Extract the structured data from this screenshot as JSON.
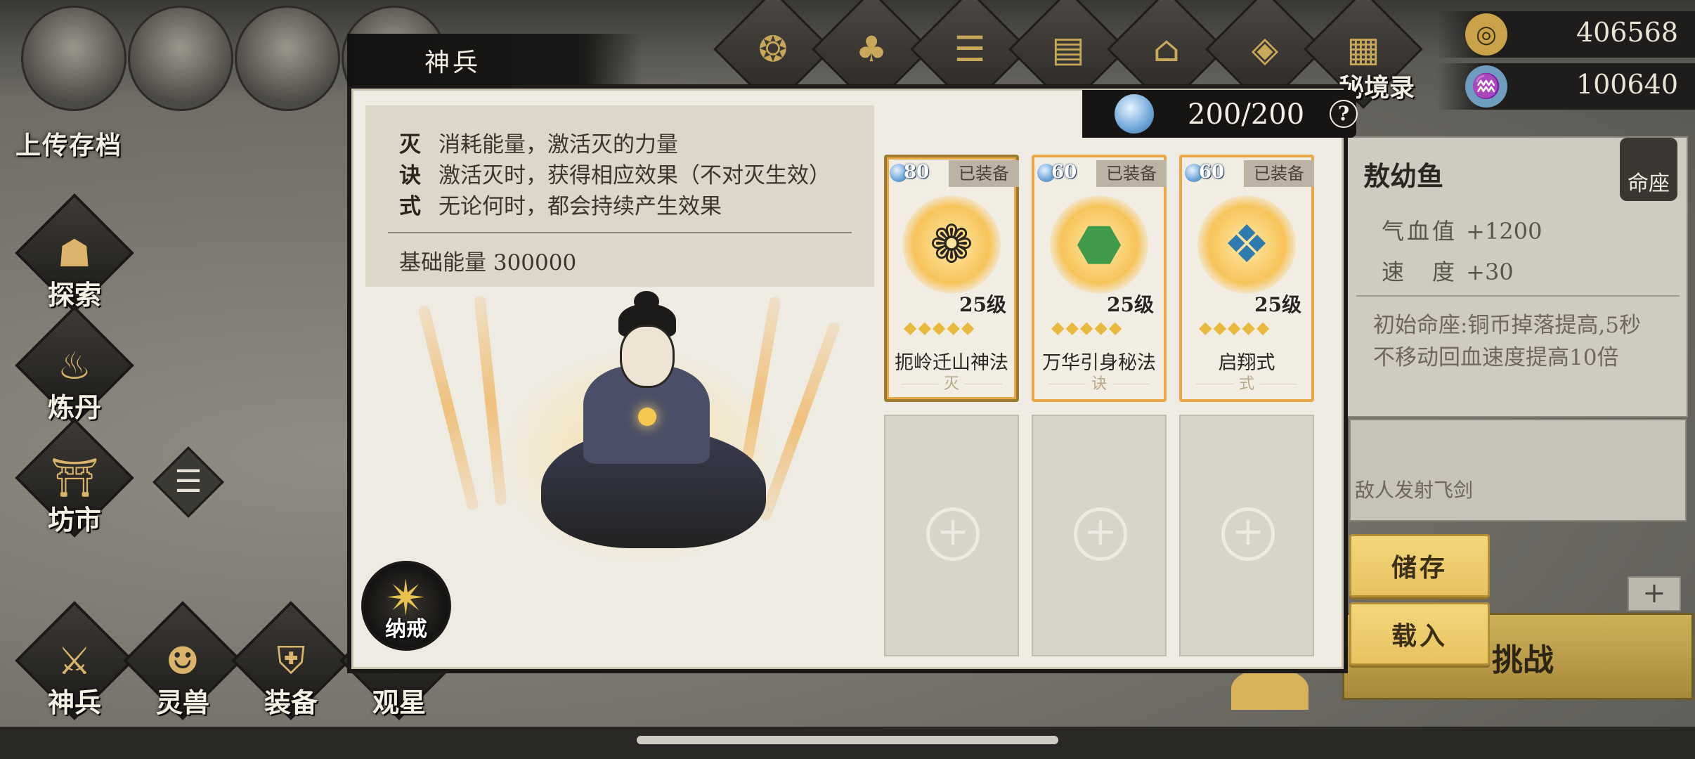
{
  "background": {
    "save_label": "上传存档",
    "nav": [
      {
        "id": "explore",
        "label": "探索",
        "icon": "lantern-icon"
      },
      {
        "id": "alchemy",
        "label": "炼丹",
        "icon": "cauldron-icon"
      },
      {
        "id": "market",
        "label": "坊市",
        "icon": "market-icon"
      }
    ],
    "bottom_nav": [
      {
        "id": "weapon",
        "label": "神兵",
        "icon": "sword-icon"
      },
      {
        "id": "beast",
        "label": "灵兽",
        "icon": "beast-mask-icon"
      },
      {
        "id": "equipment",
        "label": "装备",
        "icon": "armor-icon"
      },
      {
        "id": "stars",
        "label": "观星",
        "icon": "star-icon"
      }
    ],
    "secret_label": "秘境录",
    "resources": {
      "coins": "406568",
      "spirit": "100640"
    },
    "character": {
      "name": "敖幼鱼",
      "badge": "命座",
      "stats": [
        {
          "key": "气血值",
          "value": "+1200"
        },
        {
          "key": "速　度",
          "value": "+30"
        }
      ],
      "description": "初始命座:铜币掉落提高,5秒不移动回血速度提高10倍",
      "effect_text": "敌人发射飞剑"
    },
    "challenge_label": "挑战"
  },
  "modal": {
    "title": "神兵",
    "rules": [
      {
        "key": "灭",
        "text": "消耗能量，激活灭的力量"
      },
      {
        "key": "诀",
        "text": "激活灭时，获得相应效果（不对灭生效）"
      },
      {
        "key": "式",
        "text": "无论何时，都会持续产生效果"
      }
    ],
    "base_energy_label": "基础能量 300000",
    "ring_label": "纳戒",
    "energy": "200/200",
    "help": "?",
    "cards": [
      {
        "cost": "80",
        "equipped": "已装备",
        "level": "25级",
        "stars": "◆◆◆◆◆",
        "name": "扼岭迁山神法",
        "type": "灭",
        "art_icon": "dragon-ring-icon"
      },
      {
        "cost": "60",
        "equipped": "已装备",
        "level": "25级",
        "stars": "◆◆◆◆◆",
        "name": "万华引身秘法",
        "type": "诀",
        "art_icon": "jade-coin-icon"
      },
      {
        "cost": "60",
        "equipped": "已装备",
        "level": "25级",
        "stars": "◆◆◆◆◆",
        "name": "启翔式",
        "type": "式",
        "art_icon": "scroll-artifact-icon"
      }
    ],
    "empty_slot_symbol": "+"
  },
  "actions": {
    "save": "储存",
    "load": "载入"
  },
  "colors": {
    "gold": "#e9a74a",
    "button": "#f4d67d",
    "panel": "#eeebe3"
  }
}
